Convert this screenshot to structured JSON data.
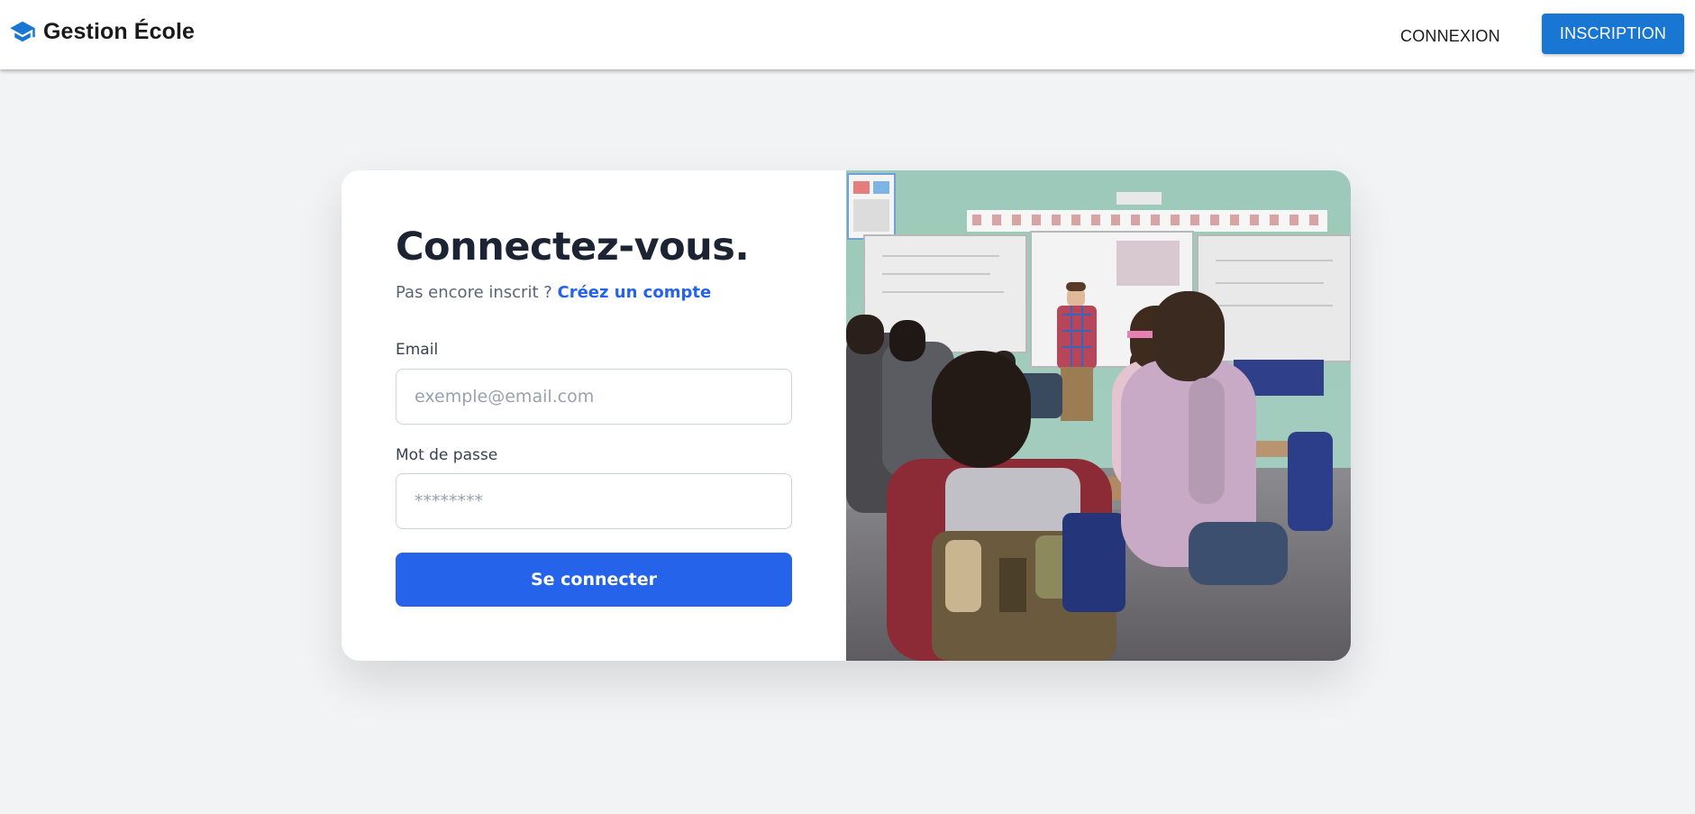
{
  "app": {
    "title": "Gestion École",
    "brand_icon": "graduation-cap-icon",
    "accent_color": "#1976d2"
  },
  "nav": {
    "login_label": "CONNEXION",
    "signup_label": "INSCRIPTION"
  },
  "login_form": {
    "title": "Connectez-vous.",
    "subtitle_text": "Pas encore inscrit ? ",
    "create_account_link": "Créez un compte",
    "email": {
      "label": "Email",
      "placeholder": "exemple@email.com",
      "value": ""
    },
    "password": {
      "label": "Mot de passe",
      "placeholder": "********",
      "value": ""
    },
    "submit_label": "Se connecter",
    "primary_color": "#2563eb"
  },
  "illustration": {
    "subject": "classroom-photo"
  }
}
